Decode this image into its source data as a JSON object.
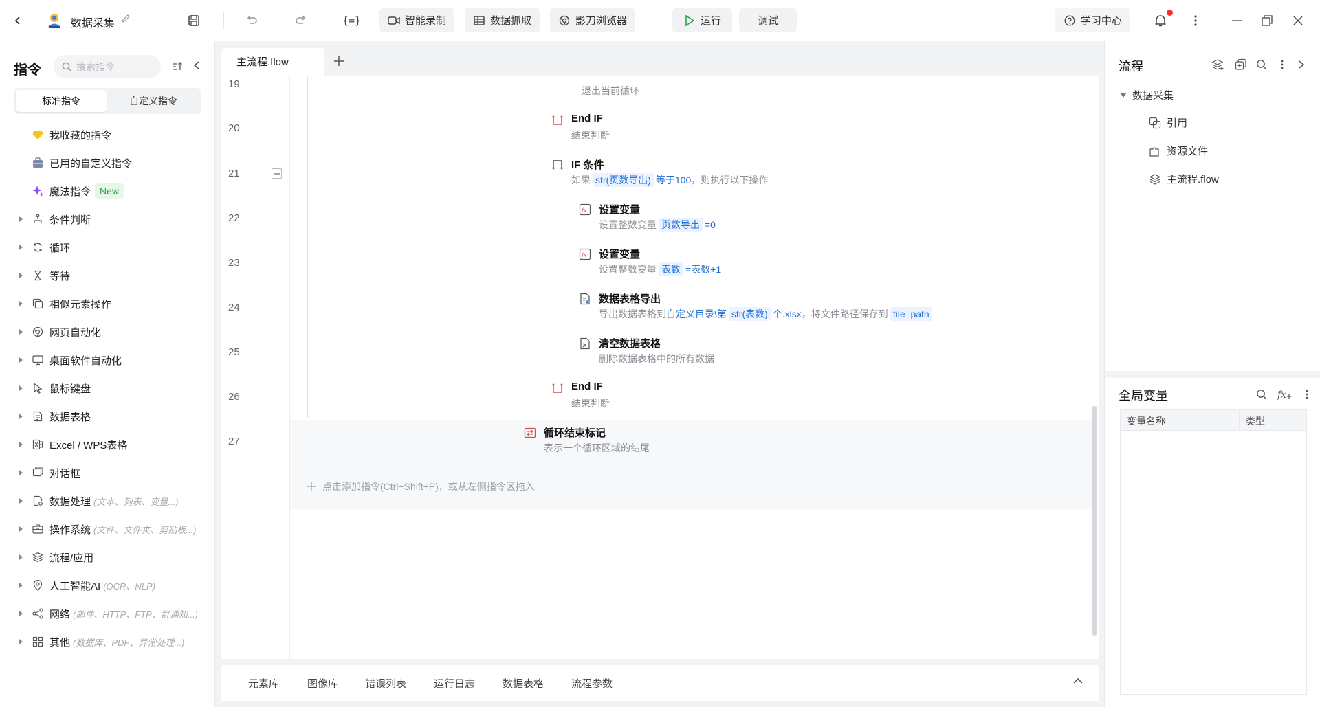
{
  "app": {
    "title": "数据采集",
    "toolbar": {
      "smart_record": "智能录制",
      "data_capture": "数据抓取",
      "browser": "影刀浏览器",
      "run": "运行",
      "debug": "调试",
      "learning_center": "学习中心"
    }
  },
  "left_panel": {
    "title": "指令",
    "search_placeholder": "搜索指令",
    "tabs": [
      "标准指令",
      "自定义指令"
    ],
    "special_items": [
      {
        "label": "我收藏的指令",
        "icon": "heart-icon"
      },
      {
        "label": "已用的自定义指令",
        "icon": "briefcase-icon"
      },
      {
        "label": "魔法指令",
        "icon": "sparkle-icon",
        "badge": "New"
      }
    ],
    "categories": [
      {
        "label": "条件判断",
        "hint": "",
        "icon": "branch-icon"
      },
      {
        "label": "循环",
        "hint": "",
        "icon": "loop-icon"
      },
      {
        "label": "等待",
        "hint": "",
        "icon": "hourglass-icon"
      },
      {
        "label": "相似元素操作",
        "hint": "",
        "icon": "similar-elements-icon"
      },
      {
        "label": "网页自动化",
        "hint": "",
        "icon": "chrome-icon"
      },
      {
        "label": "桌面软件自动化",
        "hint": "",
        "icon": "monitor-icon"
      },
      {
        "label": "鼠标键盘",
        "hint": "",
        "icon": "cursor-icon"
      },
      {
        "label": "数据表格",
        "hint": "",
        "icon": "document-icon"
      },
      {
        "label": "Excel / WPS表格",
        "hint": "",
        "icon": "excel-icon"
      },
      {
        "label": "对话框",
        "hint": "",
        "icon": "dialog-icon"
      },
      {
        "label": "数据处理",
        "hint": "(文本、列表、变量...)",
        "icon": "data-process-icon"
      },
      {
        "label": "操作系统",
        "hint": "(文件、文件夹、剪贴板...)",
        "icon": "toolbox-icon"
      },
      {
        "label": "流程/应用",
        "hint": "",
        "icon": "layers-icon"
      },
      {
        "label": "人工智能AI",
        "hint": "(OCR、NLP)",
        "icon": "ai-pin-icon"
      },
      {
        "label": "网络",
        "hint": "(邮件、HTTP、FTP、群通知...)",
        "icon": "share-icon"
      },
      {
        "label": "其他",
        "hint": "(数据库、PDF、异常处理...)",
        "icon": "grid-icon"
      }
    ]
  },
  "editor": {
    "tab_label": "主流程.flow",
    "line_numbers": [
      "19",
      "20",
      "21",
      "22",
      "23",
      "24",
      "25",
      "26",
      "27"
    ],
    "rows": {
      "r19": {
        "desc": "退出当前循环"
      },
      "r20": {
        "title": "End IF",
        "desc": "结束判断"
      },
      "r21": {
        "title": "IF 条件",
        "desc_pre": "如果",
        "chip": "str(页数导出)",
        "desc_mid": "等于100",
        "desc_post": "，则执行以下操作"
      },
      "r22": {
        "title": "设置变量",
        "desc_pre": "设置整数变量",
        "chip": "页数导出",
        "desc_post": "=0"
      },
      "r23": {
        "title": "设置变量",
        "desc_pre": "设置整数变量",
        "chip": "表数",
        "desc_post": "=表数+1"
      },
      "r24": {
        "title": "数据表格导出",
        "desc_pre": "导出数据表格到",
        "link1": "自定义目录\\第",
        "chip": "str(表数)",
        "link2": "个.xlsx",
        "desc_mid": "，将文件路径保存到",
        "chip2": "file_path"
      },
      "r25": {
        "title": "清空数据表格",
        "desc": "删除数据表格中的所有数据"
      },
      "r26": {
        "title": "End IF",
        "desc": "结束判断"
      },
      "r27": {
        "title": "循环结束标记",
        "desc": "表示一个循环区域的结尾"
      }
    },
    "add_hint": "点击添加指令(Ctrl+Shift+P)，或从左侧指令区拖入"
  },
  "bottom_tabs": [
    "元素库",
    "图像库",
    "错误列表",
    "运行日志",
    "数据表格",
    "流程参数"
  ],
  "right_panel": {
    "flow_title": "流程",
    "tree_root": "数据采集",
    "tree_items": [
      {
        "label": "引用",
        "icon": "reference-icon"
      },
      {
        "label": "资源文件",
        "icon": "puzzle-icon"
      },
      {
        "label": "主流程.flow",
        "icon": "layers-icon"
      }
    ],
    "globals_title": "全局变量",
    "var_columns": [
      "变量名称",
      "类型"
    ]
  },
  "colors": {
    "accent": "#1f6fd6",
    "run_green": "#2aa14a",
    "notification_red": "#ff2a2a",
    "end_if_red": "#d04a4a"
  }
}
